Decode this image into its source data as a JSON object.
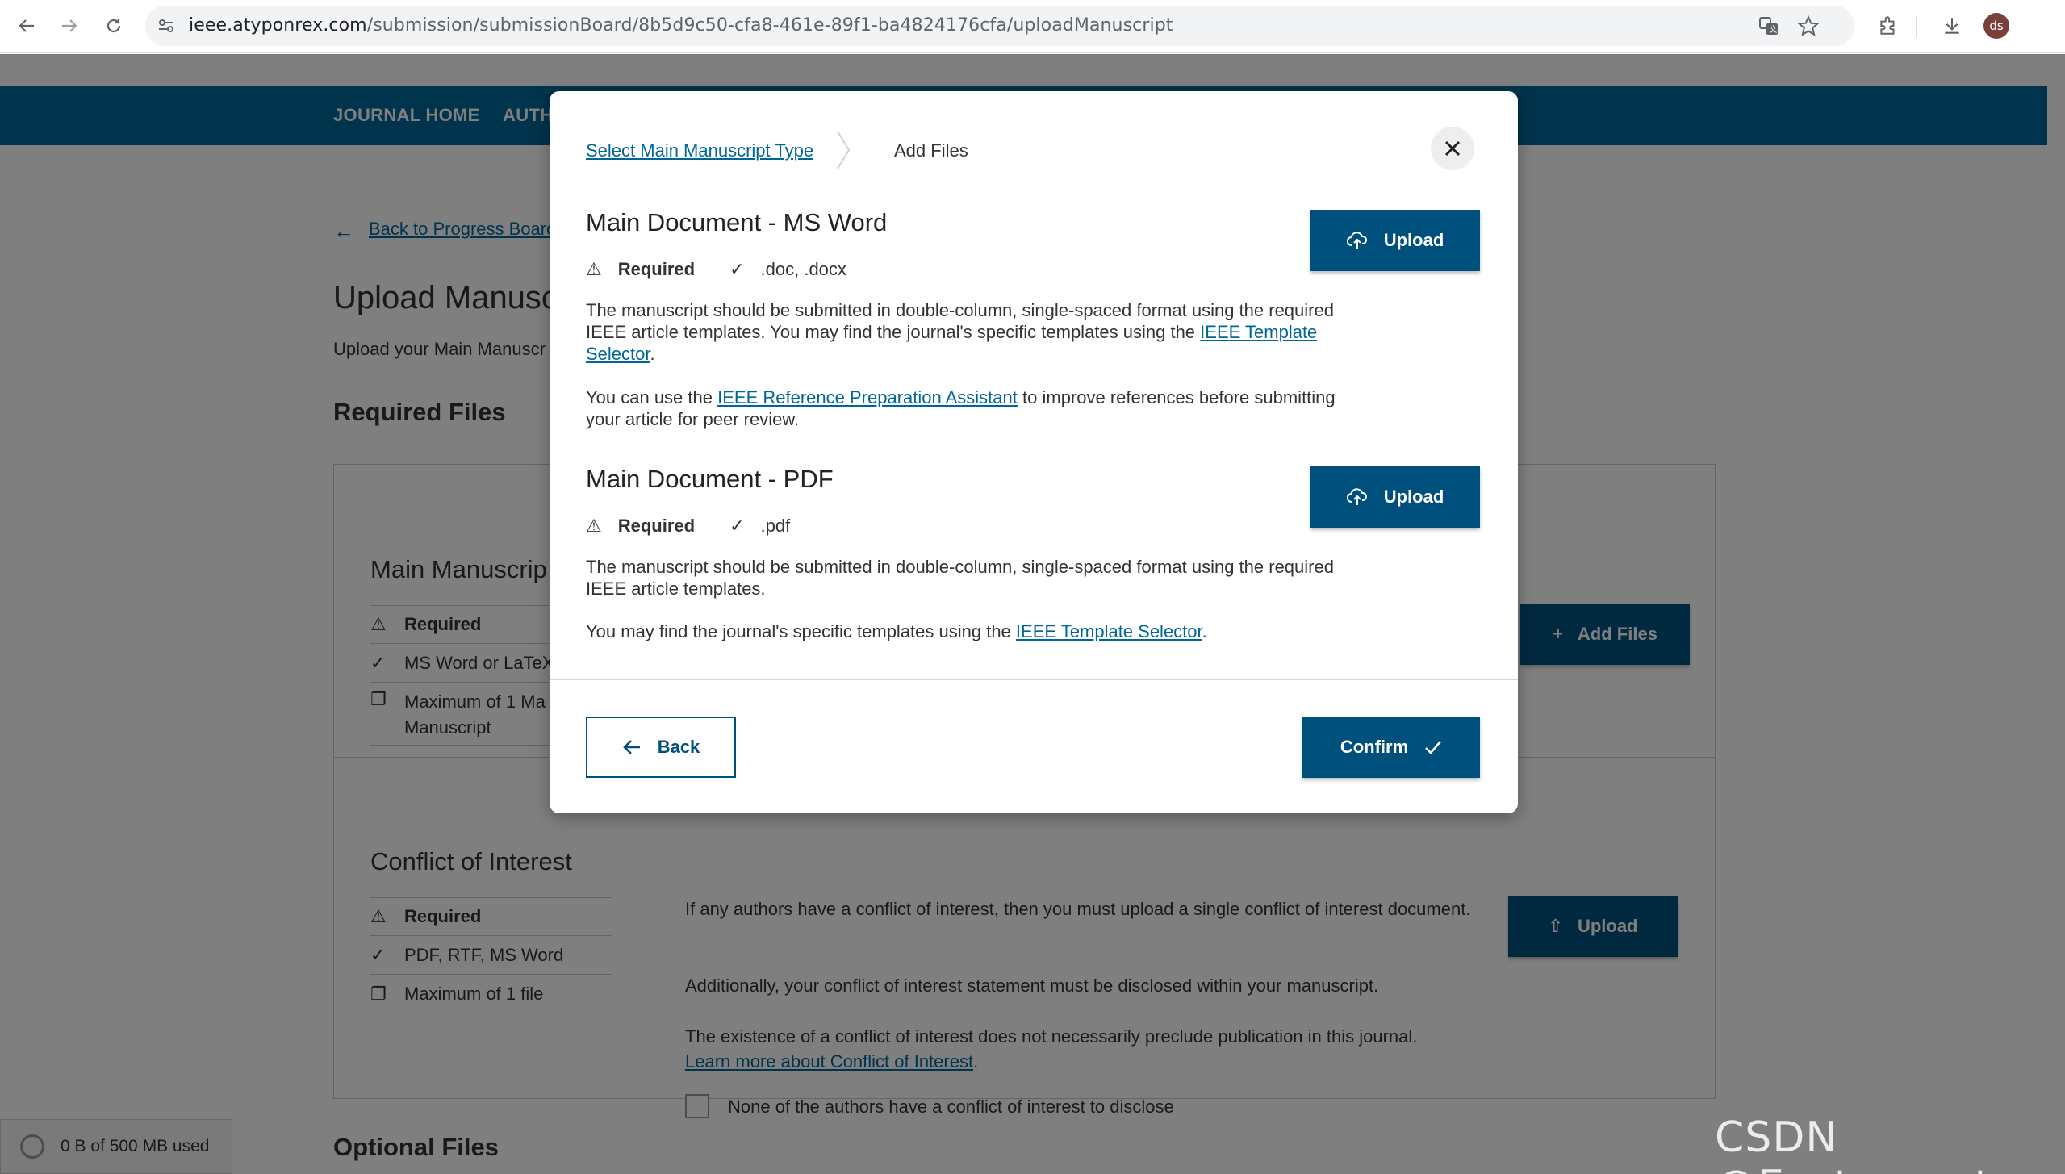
{
  "browser": {
    "url_host": "ieee.atyponrex.com",
    "url_path": "/submission/submissionBoard/8b5d9c50-cfa8-461e-89f1-ba4824176cfa/uploadManuscript",
    "avatar_initials": "ds"
  },
  "site_nav": {
    "items": [
      "JOURNAL HOME",
      "AUTH"
    ]
  },
  "background": {
    "back_link": "Back to Progress Board",
    "page_title": "Upload Manusc",
    "page_subtitle": "Upload your Main Manuscr",
    "required_files_heading": "Required Files",
    "main_manuscript": {
      "title": "Main Manuscrip",
      "rows": [
        "Required",
        "MS Word or LaTeX",
        "Maximum of 1 Ma",
        "Manuscript"
      ],
      "add_files_label": "Add Files"
    },
    "conflict": {
      "title": "Conflict of Interest",
      "rows": [
        "Required",
        "PDF, RTF, MS Word",
        "Maximum of 1 file"
      ],
      "text_1": "If any authors have a conflict of interest, then you must upload a single conflict of interest document.",
      "text_2": "Additionally, your conflict of interest statement must be disclosed within your manuscript.",
      "text_3": "The existence of a conflict of interest does not necessarily preclude publication in this journal.",
      "learn_more_link": "Learn more about Conflict of Interest",
      "checkbox_label": "None of the authors have a conflict of interest to disclose",
      "upload_label": "Upload"
    },
    "optional_files_heading": "Optional Files",
    "storage_text": "0 B of 500 MB used"
  },
  "modal": {
    "breadcrumb_step1": "Select Main Manuscript Type",
    "breadcrumb_step2": "Add Files",
    "word": {
      "title": "Main Document - MS Word",
      "required": "Required",
      "formats": ".doc, .docx",
      "p1_text": "The manuscript should be submitted in double-column, single-spaced format using the required IEEE article templates. You may find the journal's specific templates using the",
      "p1_link": "IEEE Template Selector",
      "p2_before": "You can use the",
      "p2_link": "IEEE Reference Preparation Assistant",
      "p2_after": "to improve references before submitting your article for peer review.",
      "upload_label": "Upload"
    },
    "pdf": {
      "title": "Main Document - PDF",
      "required": "Required",
      "formats": ".pdf",
      "p1_text": "The manuscript should be submitted in double-column, single-spaced format using the required IEEE article templates.",
      "p2_before": "You may find the journal's specific templates using the",
      "p2_link": "IEEE Template Selector",
      "upload_label": "Upload"
    },
    "back_label": "Back",
    "confirm_label": "Confirm"
  },
  "watermark": "CSDN @Eastmount"
}
